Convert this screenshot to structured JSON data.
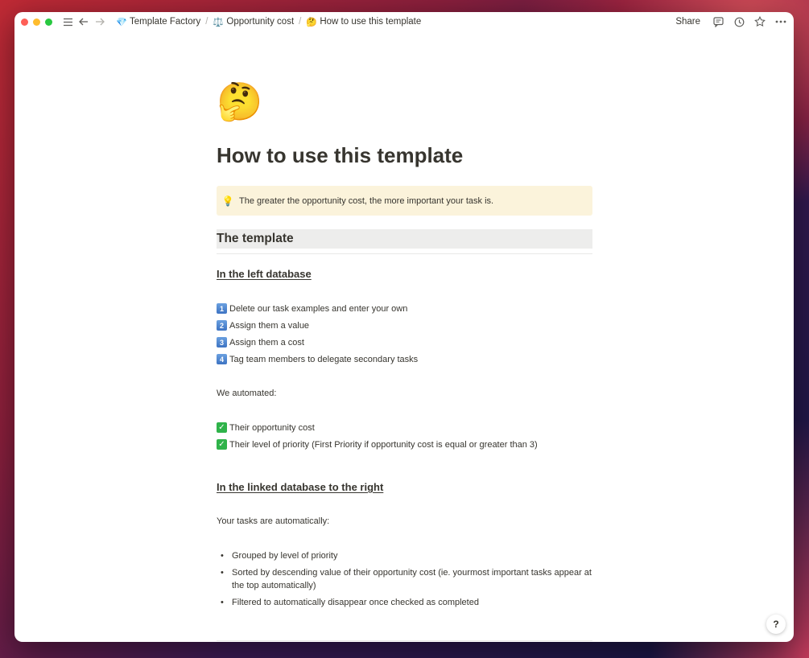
{
  "breadcrumbs": [
    {
      "icon": "gem-icon",
      "glyph": "💎",
      "label": "Template Factory"
    },
    {
      "icon": "scales-icon",
      "glyph": "⚖️",
      "label": "Opportunity cost"
    },
    {
      "icon": "thinking-face-icon",
      "glyph": "🤔",
      "label": "How to use this template"
    }
  ],
  "topbar": {
    "share_label": "Share"
  },
  "page": {
    "emoji": "🤔",
    "title": "How to use this template",
    "callout": {
      "icon": "💡",
      "text": "The greater the opportunity cost, the more important your task is."
    },
    "section_heading": "The template",
    "left_db": {
      "heading": "In the left database",
      "steps": [
        {
          "num": "1",
          "text": "Delete our task examples and enter your own"
        },
        {
          "num": "2",
          "text": "Assign them a value"
        },
        {
          "num": "3",
          "text": "Assign them a cost"
        },
        {
          "num": "4",
          "text": "Tag team members to delegate secondary tasks"
        }
      ],
      "automated_label": "We automated:",
      "automated": [
        {
          "text": "Their opportunity cost"
        },
        {
          "text": "Their level of priority (First Priority if opportunity cost is equal or greater than 3)"
        }
      ]
    },
    "linked_db": {
      "heading": "In the linked database to the right",
      "intro": "Your tasks are automatically:",
      "bullets": [
        {
          "text": "Grouped by level of priority"
        },
        {
          "text": "Sorted by descending value of their opportunity cost (ie. yourmost important tasks appear at the top automatically)"
        },
        {
          "text": "Filtered to automatically disappear once checked as completed"
        }
      ]
    }
  },
  "help": {
    "label": "?"
  },
  "colors": {
    "callout_bg": "#fbf3db",
    "heading_bg": "#ededec",
    "text": "#37352f"
  }
}
